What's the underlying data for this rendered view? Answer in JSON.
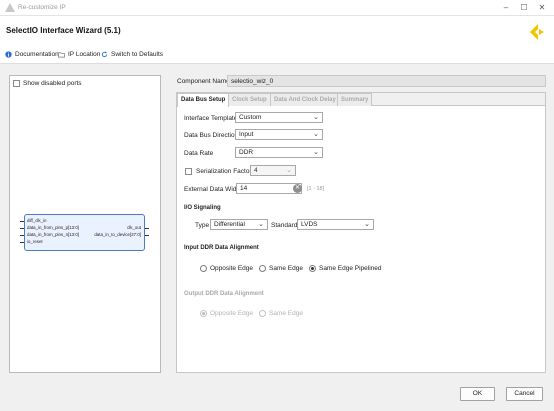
{
  "window": {
    "title": "Re-customize IP",
    "minimize": "–",
    "maximize": "☐",
    "close": "✕"
  },
  "wizard": {
    "title": "SelectIO Interface Wizard (5.1)"
  },
  "toolbar": {
    "documentation": "Documentation",
    "ip_location": "IP Location",
    "switch_defaults": "Switch to Defaults"
  },
  "left": {
    "show_disabled_ports": "Show disabled ports",
    "block": {
      "inputs": [
        "diff_clk_in",
        "data_in_from_pins_p[13:0]",
        "data_in_from_pins_n[13:0]",
        "io_reset"
      ],
      "outputs": [
        "clk_out",
        "data_in_to_device[27:0]"
      ]
    }
  },
  "component": {
    "label": "Component Name",
    "value": "selectio_wiz_0"
  },
  "tabs": [
    {
      "label": "Data Bus Setup",
      "active": true
    },
    {
      "label": "Clock Setup",
      "active": false
    },
    {
      "label": "Data And Clock Delay",
      "active": false
    },
    {
      "label": "Summary",
      "active": false
    }
  ],
  "form": {
    "interface_template": {
      "label": "Interface Template",
      "value": "Custom"
    },
    "data_bus_direction": {
      "label": "Data Bus Direction",
      "value": "Input"
    },
    "data_rate": {
      "label": "Data Rate",
      "value": "DDR"
    },
    "serialization": {
      "label": "Serialization Factor",
      "value": "4"
    },
    "external_width": {
      "label": "External Data Width",
      "value": "14",
      "range": "[1 - 18]"
    }
  },
  "io_signaling": {
    "title": "I/O Signaling",
    "type_label": "Type",
    "type_value": "Differential",
    "standard_label": "Standard",
    "standard_value": "LVDS"
  },
  "input_ddr": {
    "title": "Input DDR Data Alignment",
    "options": [
      "Opposite Edge",
      "Same Edge",
      "Same Edge Pipelined"
    ],
    "selected": "Same Edge Pipelined"
  },
  "output_ddr": {
    "title": "Output DDR Data Alignment",
    "options": [
      "Opposite Edge",
      "Same Edge"
    ],
    "selected": "Opposite Edge"
  },
  "buttons": {
    "ok": "OK",
    "cancel": "Cancel"
  },
  "colors": {
    "accent": "#2b6bd1",
    "logo": "#f4c300",
    "block_fill": "#eaf2ff",
    "block_border": "#4b7bc4"
  }
}
